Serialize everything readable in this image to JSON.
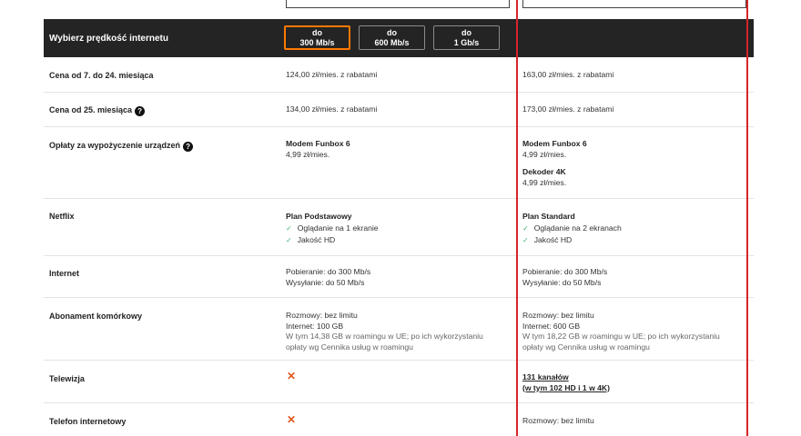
{
  "header": {
    "label": "Wybierz prędkość internetu",
    "speeds": [
      {
        "line1": "do",
        "line2": "300 Mb/s",
        "selected": true
      },
      {
        "line1": "do",
        "line2": "600 Mb/s",
        "selected": false
      },
      {
        "line1": "do",
        "line2": "1 Gb/s",
        "selected": false
      }
    ]
  },
  "rows": {
    "price_7_24": {
      "label": "Cena od 7. do 24. miesiąca",
      "plan1": "124,00 zł/mies. z rabatami",
      "plan2": "163,00 zł/mies. z rabatami"
    },
    "price_25": {
      "label": "Cena od 25. miesiąca",
      "plan1": "134,00 zł/mies. z rabatami",
      "plan2": "173,00 zł/mies. z rabatami"
    },
    "rental": {
      "label": "Opłaty za wypożyczenie urządzeń",
      "plan1": {
        "device": "Modem Funbox 6",
        "price": "4,99 zł/mies."
      },
      "plan2": {
        "device1": "Modem Funbox 6",
        "price1": "4,99 zł/mies.",
        "device2": "Dekoder 4K",
        "price2": "4,99 zł/mies."
      }
    },
    "netflix": {
      "label": "Netflix",
      "plan1": {
        "title": "Plan Podstawowy",
        "f1": "Oglądanie na 1 ekranie",
        "f2": "Jakość HD"
      },
      "plan2": {
        "title": "Plan Standard",
        "f1": "Oglądanie na 2 ekranach",
        "f2": "Jakość HD"
      }
    },
    "internet": {
      "label": "Internet",
      "plan1": {
        "down": "Pobieranie: do 300 Mb/s",
        "up": "Wysyłanie: do 50 Mb/s"
      },
      "plan2": {
        "down": "Pobieranie: do 300 Mb/s",
        "up": "Wysyłanie: do 50 Mb/s"
      }
    },
    "mobile": {
      "label": "Abonament komórkowy",
      "plan1": {
        "calls": "Rozmowy: bez limitu",
        "data": "Internet: 100 GB",
        "roam1": "W tym 14,38 GB w roamingu w UE; po ich wykorzystaniu",
        "roam2": "opłaty wg Cennika usług w roamingu"
      },
      "plan2": {
        "calls": "Rozmowy: bez limitu",
        "data": "Internet: 600 GB",
        "roam1": "W tym 18,22 GB w roamingu w UE; po ich wykorzystaniu",
        "roam2": "opłaty wg Cennika usług w roamingu"
      }
    },
    "tv": {
      "label": "Telewizja",
      "plan1": "✕",
      "plan2": {
        "line1": "131 kanałów",
        "line2": "(w tym 102 HD i 1 w 4K)"
      }
    },
    "phone": {
      "label": "Telefon internetowy",
      "plan1": "✕",
      "plan2": "Rozmowy: bez limitu"
    }
  },
  "icons": {
    "help": "?",
    "check": "✓"
  },
  "colors": {
    "accent": "#ff7900",
    "highlight": "#d8232a",
    "header_bg": "#242424",
    "check": "#3cb46e",
    "cross": "#e35a1d"
  }
}
